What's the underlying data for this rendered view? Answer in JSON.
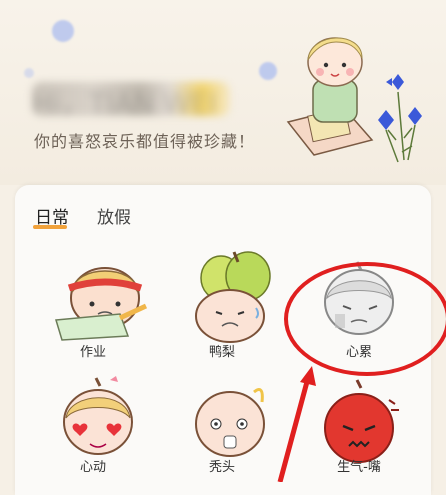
{
  "header": {
    "greeting": "Hi，TIAN WEI",
    "subtitle": "你的喜怒哀乐都值得被珍藏！"
  },
  "tabs": [
    {
      "label": "日常",
      "active": true
    },
    {
      "label": "放假",
      "active": false
    }
  ],
  "stickers": [
    {
      "label": "作业",
      "icon": "homework-face-icon"
    },
    {
      "label": "鸭梨",
      "icon": "pear-face-icon"
    },
    {
      "label": "心累",
      "icon": "tired-face-icon"
    },
    {
      "label": "心动",
      "icon": "heart-eyes-face-icon"
    },
    {
      "label": "秃头",
      "icon": "bald-face-icon"
    },
    {
      "label": "生气-嘴",
      "icon": "angry-face-icon"
    }
  ],
  "colors": {
    "accent": "#f1a23b",
    "annotation": "#e01f1f",
    "background": "#f6f0e6"
  }
}
